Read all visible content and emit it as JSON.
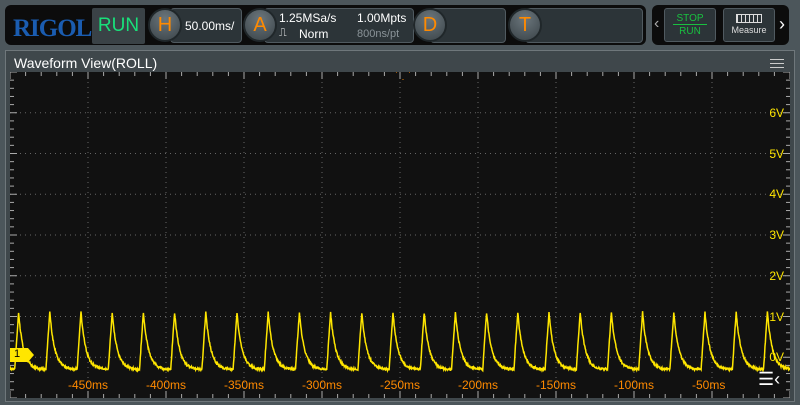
{
  "toolbar": {
    "logo": "RIGOL",
    "run_state": "RUN",
    "horizontal": {
      "key": "H",
      "timebase": "50.00ms/"
    },
    "acquire": {
      "key": "A",
      "sample_rate": "1.25MSa/s",
      "mode": "Norm",
      "memory_depth": "1.00Mpts",
      "sample_interval": "800ns/pt"
    },
    "decode": {
      "key": "D"
    },
    "trigger": {
      "key": "T"
    }
  },
  "quick": {
    "stop": "STOP",
    "run": "RUN",
    "measure": "Measure"
  },
  "window": {
    "title": "Waveform View(ROLL)"
  },
  "channel": {
    "label": "1",
    "color": "#ffe600"
  },
  "voltage_labels": [
    "6V",
    "5V",
    "4V",
    "3V",
    "2V",
    "1V",
    "0V"
  ],
  "time_labels": [
    "-450ms",
    "-400ms",
    "-350ms",
    "-300ms",
    "-250ms",
    "-200ms",
    "-150ms",
    "-100ms",
    "-50ms"
  ],
  "colors": {
    "accent": "#ff8a00",
    "run": "#19e07a",
    "trace": "#ffe600",
    "logo": "#1a5cb0"
  }
}
